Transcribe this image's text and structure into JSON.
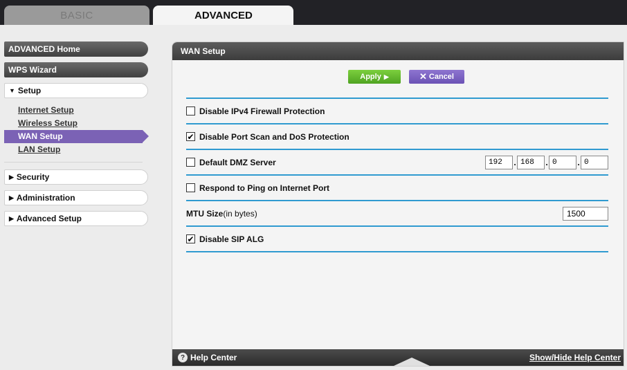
{
  "tabs": {
    "basic": "BASIC",
    "advanced": "ADVANCED"
  },
  "sidebar": {
    "advanced_home": "ADVANCED Home",
    "wps_wizard": "WPS Wizard",
    "setup": {
      "arrow": "▼",
      "label": "Setup"
    },
    "setup_items": [
      "Internet Setup",
      "Wireless Setup",
      "WAN Setup",
      "LAN Setup"
    ],
    "security": {
      "arrow": "▶",
      "label": "Security"
    },
    "administration": {
      "arrow": "▶",
      "label": "Administration"
    },
    "advanced_setup": {
      "arrow": "▶",
      "label": "Advanced Setup"
    }
  },
  "panel": {
    "title": "WAN Setup",
    "apply_label": "Apply",
    "cancel_label": "Cancel",
    "options": {
      "firewall": {
        "label": "Disable IPv4 Firewall Protection",
        "checked": false
      },
      "portscan": {
        "label": "Disable Port Scan and DoS Protection",
        "checked": true
      },
      "dmz": {
        "label": "Default DMZ Server",
        "checked": false,
        "ip": [
          "192",
          "168",
          "0",
          "0"
        ]
      },
      "ping": {
        "label": "Respond to Ping on Internet Port",
        "checked": false
      },
      "mtu": {
        "label": "MTU Size",
        "unit": "(in bytes)",
        "value": "1500"
      },
      "sip": {
        "label": "Disable SIP ALG",
        "checked": true
      }
    },
    "check_mark": "✔"
  },
  "footer": {
    "help_icon": "?",
    "help_label": "Help Center",
    "toggle_label": "Show/Hide Help Center"
  },
  "colors": {
    "accent_purple": "#7b62b5",
    "apply_green": "#5cb22b",
    "rule_blue": "#2f9ad0"
  }
}
